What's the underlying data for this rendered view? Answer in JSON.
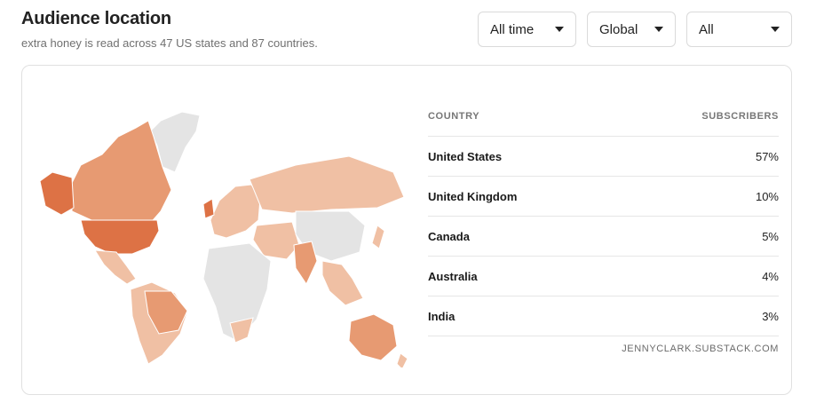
{
  "header": {
    "title": "Audience location",
    "subtitle": "extra honey is read across 47 US states and 87 countries."
  },
  "filters": [
    {
      "value": "All time"
    },
    {
      "value": "Global"
    },
    {
      "value": "All"
    }
  ],
  "table": {
    "col_country": "COUNTRY",
    "col_subscribers": "SUBSCRIBERS",
    "rows": [
      {
        "country": "United States",
        "pct": "57%"
      },
      {
        "country": "United Kingdom",
        "pct": "10%"
      },
      {
        "country": "Canada",
        "pct": "5%"
      },
      {
        "country": "Australia",
        "pct": "4%"
      },
      {
        "country": "India",
        "pct": "3%"
      }
    ]
  },
  "source": "JENNYCLARK.SUBSTACK.COM",
  "colors": {
    "none": "#e4e4e4",
    "low": "#f0c0a4",
    "medium": "#e79a72",
    "high": "#dd7245"
  }
}
